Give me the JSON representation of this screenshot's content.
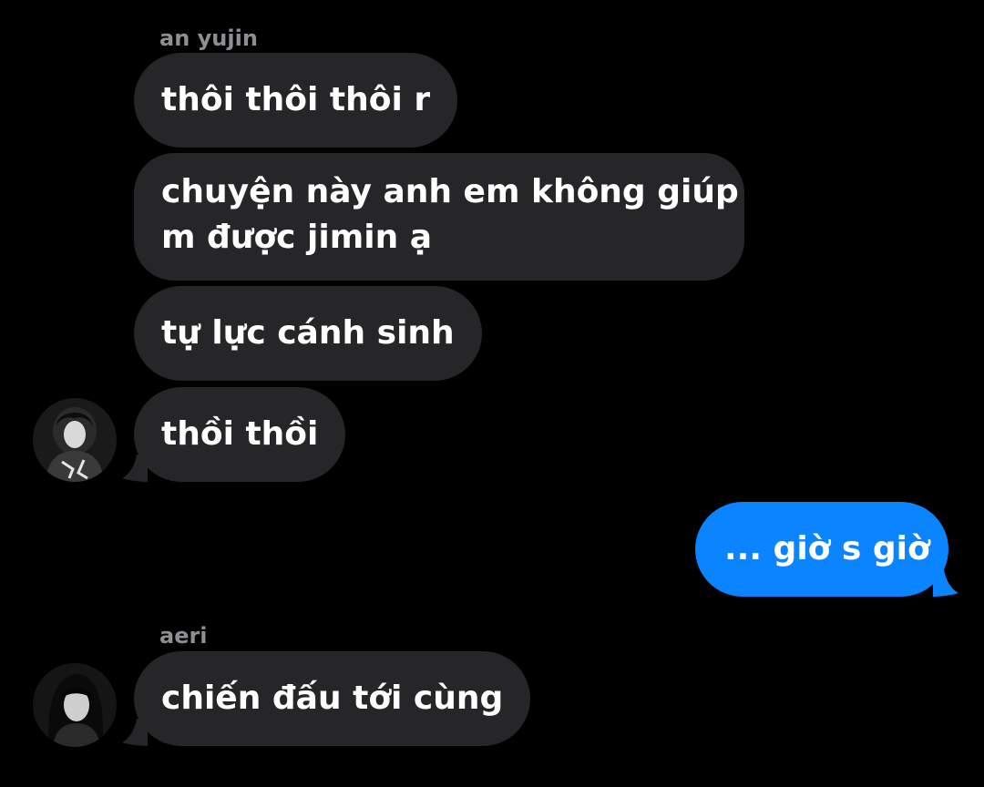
{
  "conversation": {
    "groups": [
      {
        "sender": "an yujin",
        "messages": [
          "thôi thôi thôi r",
          "chuyện này anh em không giúp",
          "m được jimin ạ",
          "tự lực cánh sinh",
          "thồi thồi"
        ]
      },
      {
        "sender": "",
        "messages": [
          "... giờ s giờ"
        ]
      },
      {
        "sender": "aeri",
        "messages": [
          "chiến đấu tới cùng"
        ]
      }
    ]
  },
  "colors": {
    "background": "#000000",
    "incoming_bubble": "#262628",
    "outgoing_bubble": "#0a84ff",
    "sender_name": "#8e8e93",
    "message_text": "#ffffff"
  },
  "icons": {
    "avatar_yujin": "avatar-photo",
    "avatar_aeri": "avatar-photo"
  }
}
